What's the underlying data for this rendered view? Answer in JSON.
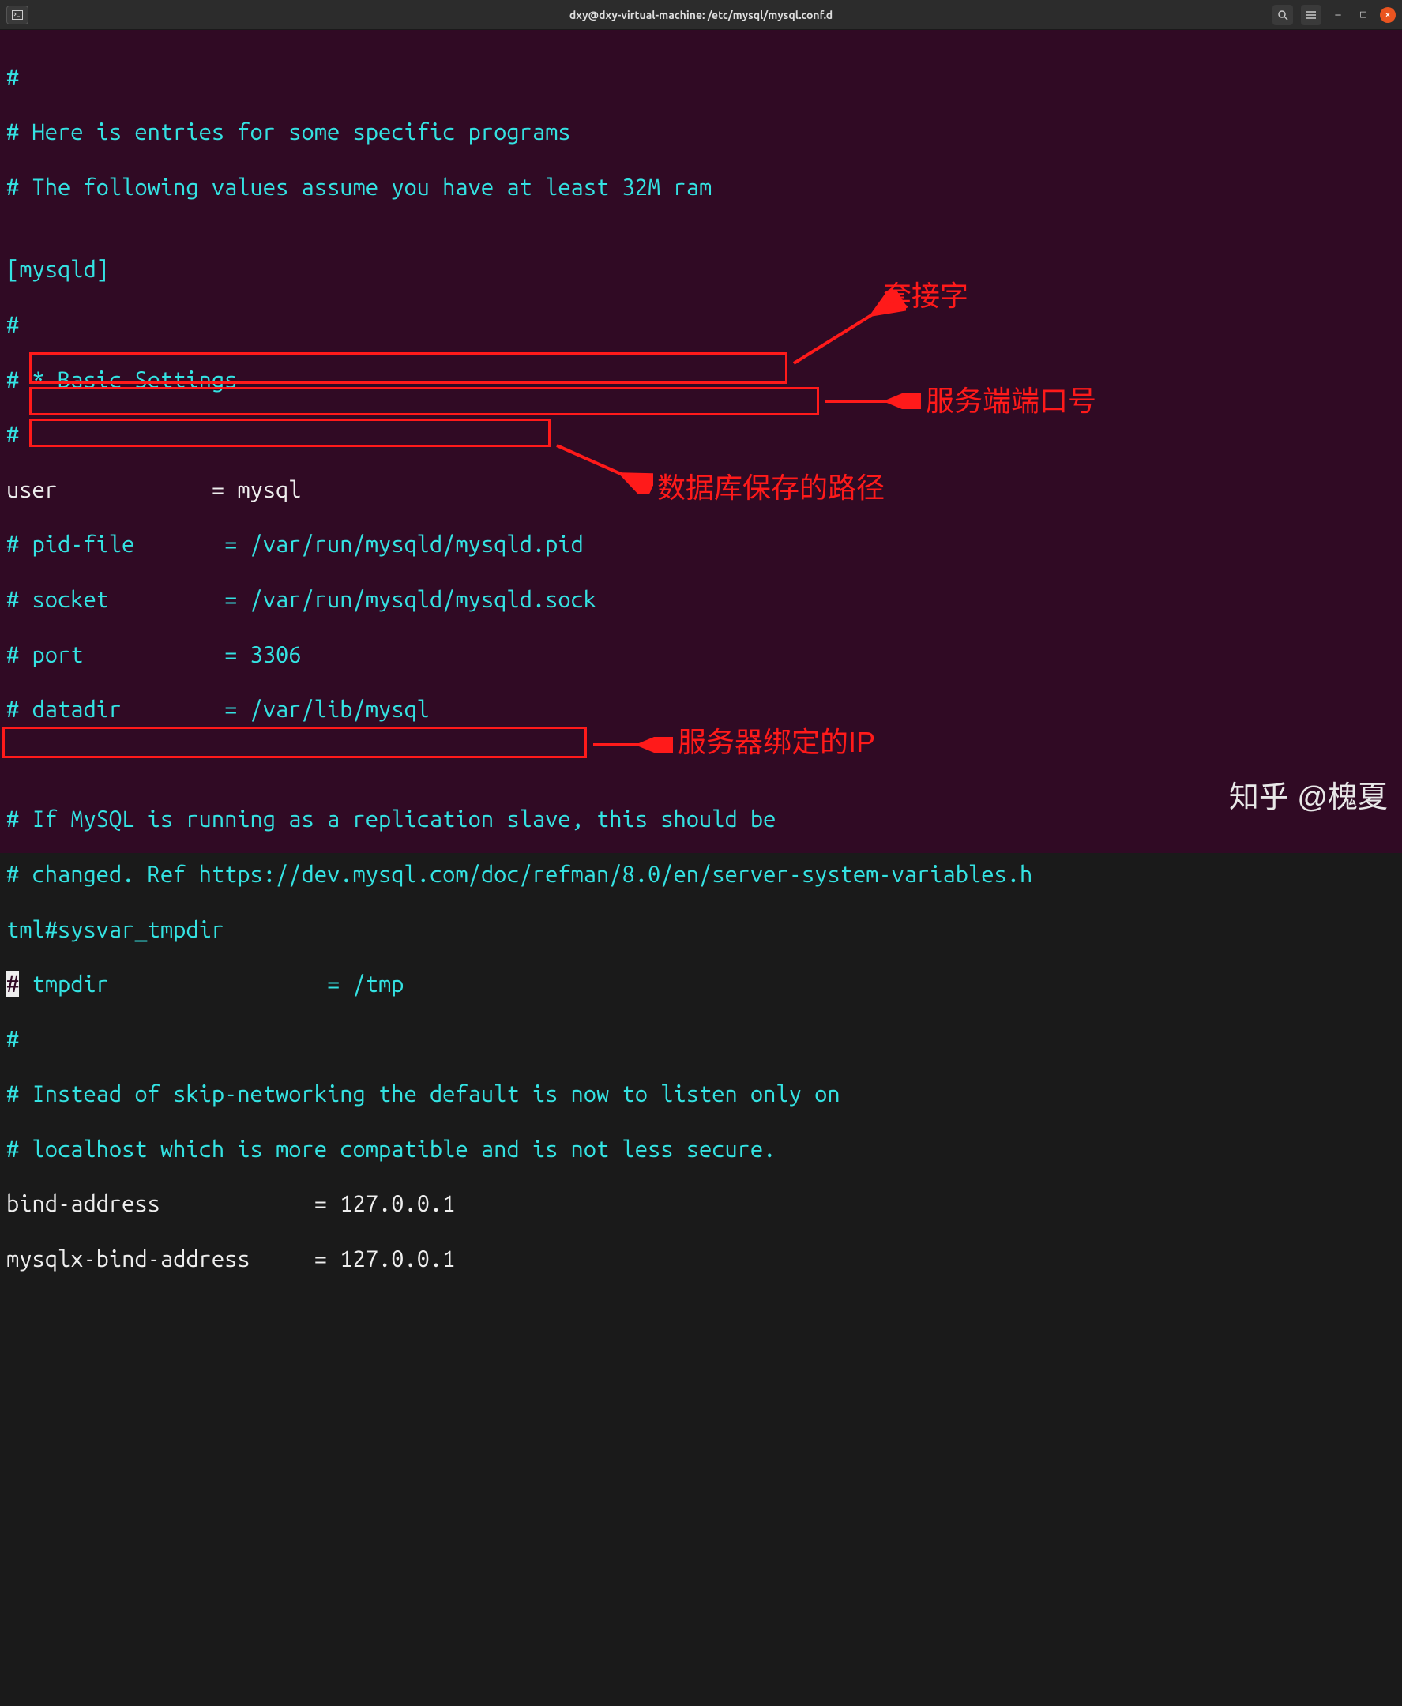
{
  "titlebar": {
    "title": "dxy@dxy-virtual-machine: /etc/mysql/mysql.conf.d",
    "terminal_icon": "⌂",
    "search_icon": "🔍",
    "menu_icon": "≡",
    "min": "—",
    "max": "□",
    "close": "×"
  },
  "config": {
    "l1": "#",
    "l2": "# Here is entries for some specific programs",
    "l3": "# The following values assume you have at least 32M ram",
    "l4": "",
    "l5": "[mysqld]",
    "l6": "#",
    "l7": "# * Basic Settings",
    "l8": "#",
    "l9a": "user",
    "l9b": "            = mysql",
    "l10": "# pid-file       = /var/run/mysqld/mysqld.pid",
    "l11": "# socket         = /var/run/mysqld/mysqld.sock",
    "l12": "# port           = 3306",
    "l13": "# datadir        = /var/lib/mysql",
    "l14": "",
    "l15": "",
    "l16": "# If MySQL is running as a replication slave, this should be",
    "l17": "# changed. Ref https://dev.mysql.com/doc/refman/8.0/en/server-system-variables.h",
    "l18": "tml#sysvar_tmpdir",
    "l19a": "#",
    "l19b": " tmpdir                 = /tmp",
    "l20": "#",
    "l21": "# Instead of skip-networking the default is now to listen only on",
    "l22": "# localhost which is more compatible and is not less secure.",
    "l23a": "bind-address",
    "l23b": "            = 127.0.0.1",
    "l24a": "mysqlx-bind-address",
    "l24b": "     = 127.0.0.1"
  },
  "annotations": {
    "socket": "套接字",
    "port": "服务端端口号",
    "datadir": "数据库保存的路径",
    "bind": "服务器绑定的IP"
  },
  "watermark": "知乎 @槐夏"
}
